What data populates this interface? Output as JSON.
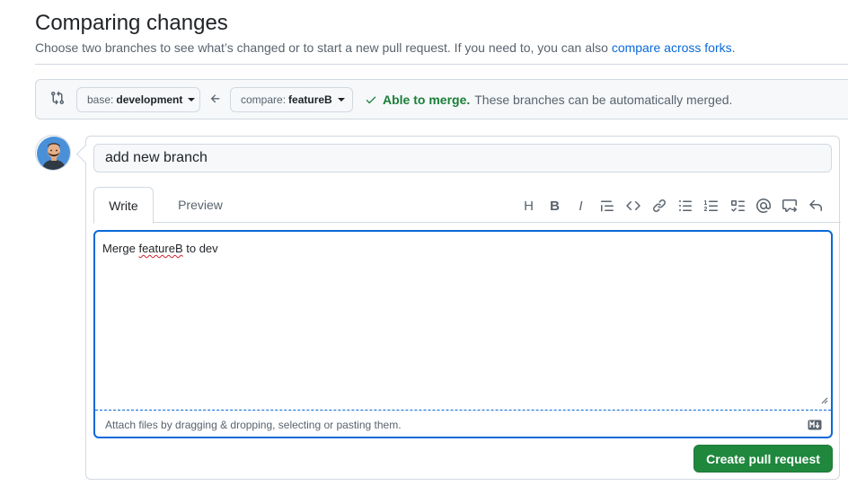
{
  "header": {
    "title": "Comparing changes",
    "subtitle": "Choose two branches to see what’s changed or to start a new pull request. If you need to, you can also ",
    "subtitle_link": "compare across forks",
    "subtitle_end": "."
  },
  "range": {
    "base_prefix": "base:",
    "base_branch": "development",
    "compare_prefix": "compare:",
    "compare_branch": "featureB",
    "merge_status": "Able to merge.",
    "merge_description": "These branches can be automatically merged."
  },
  "pull_request": {
    "title_value": "add new branch",
    "tabs": [
      {
        "label": "Write",
        "active": true
      },
      {
        "label": "Preview",
        "active": false
      }
    ],
    "toolbar_icons": [
      "heading-icon",
      "bold-icon",
      "italic-icon",
      "quote-icon",
      "code-icon",
      "link-icon",
      "unordered-list-icon",
      "ordered-list-icon",
      "task-list-icon",
      "mention-icon",
      "reference-icon",
      "undo-icon"
    ],
    "toolbar_heading_label": "H",
    "toolbar_bold_label": "B",
    "toolbar_italic_label": "I",
    "body_prefix": "Merge ",
    "body_misspelled": "featureB",
    "body_suffix": " to dev",
    "attach_hint": "Attach files by dragging & dropping, selecting or pasting them.",
    "submit_label": "Create pull request"
  },
  "colors": {
    "accent": "#0969da",
    "success": "#1a7f37",
    "button_green": "#1f883d"
  }
}
